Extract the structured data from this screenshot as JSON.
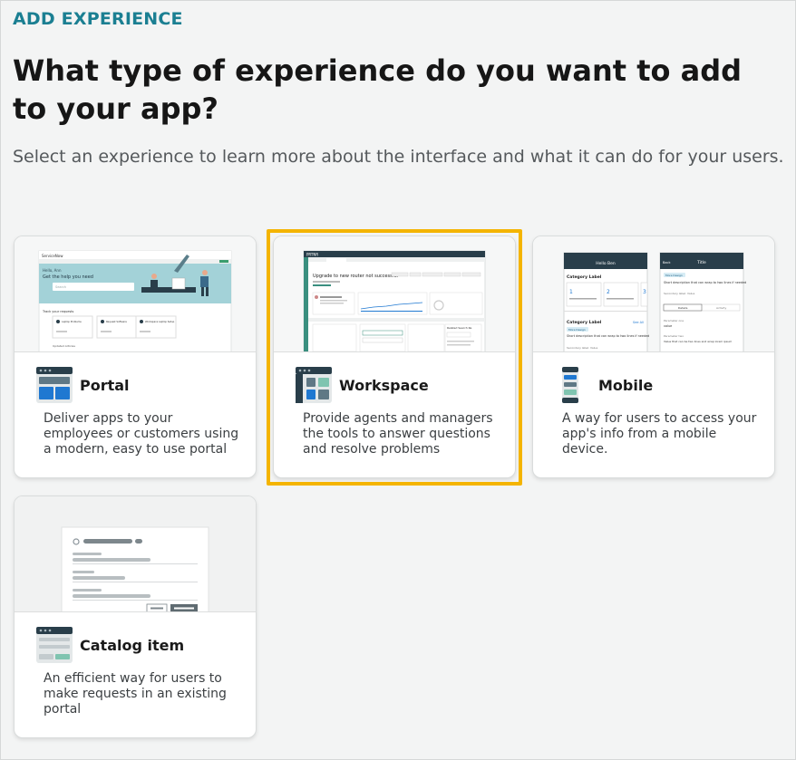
{
  "header": {
    "eyebrow": "ADD EXPERIENCE",
    "title": "What type of experience do you want to add to your app?",
    "subtitle": "Select an experience to learn more about the interface and what it can do for your users."
  },
  "cards": [
    {
      "id": "portal",
      "title": "Portal",
      "description": "Deliver apps to your employees or customers using a modern, easy to use portal",
      "icon": "portal-layout-icon",
      "preview": {
        "brand": "ServiceNow",
        "greeting": "Hello, Ann",
        "heading": "Get the help you need",
        "search_placeholder": "Search",
        "section_label": "Track your requests",
        "tiles": [
          "Laptop Problems",
          "Request Software",
          "Workspace Laptop Setup"
        ],
        "footer_label": "Updated Articles"
      }
    },
    {
      "id": "workspace",
      "title": "Workspace",
      "description": "Provide agents and managers the tools to answer questions and resolve problems",
      "icon": "workspace-layout-icon",
      "selected": true,
      "preview": {
        "brand": "PRTNR",
        "record_title": "Upgrade to new router not successful",
        "panel_right": "Related Search Re"
      }
    },
    {
      "id": "mobile",
      "title": "Mobile",
      "description": "A way for users to access your app's info from a mobile device.",
      "icon": "mobile-phone-icon",
      "preview": {
        "screen1": {
          "header": "Hello Ben",
          "section1": "Category Label",
          "stats": [
            "1",
            "2",
            "3"
          ],
          "section2": "Category Label",
          "see_all": "See All",
          "chip": "More Design",
          "text": "Short description that can wrap to two lines if needed",
          "meta": "Secondary label: Value"
        },
        "screen2": {
          "back": "Back",
          "header": "Title",
          "chip": "More Design",
          "text": "Short description that can wrap to two lines if needed",
          "meta": "Secondary label: Value",
          "tab_active": "Details",
          "tab_other": "Activity",
          "field1_label": "Parameter one",
          "field1_value": "value",
          "field2_label": "Parameter two",
          "field2_value": "Value that can be two lines and wrap lorem ipsum"
        }
      }
    },
    {
      "id": "catalog",
      "title": "Catalog item",
      "description": "An efficient way for users to make requests in an existing portal",
      "icon": "catalog-form-icon"
    }
  ],
  "colors": {
    "accent_teal": "#1b7f92",
    "selection_ring": "#f4b400",
    "dark_navy": "#293e4a",
    "brand_blue": "#1f78d1",
    "mint": "#7fc4b0"
  }
}
